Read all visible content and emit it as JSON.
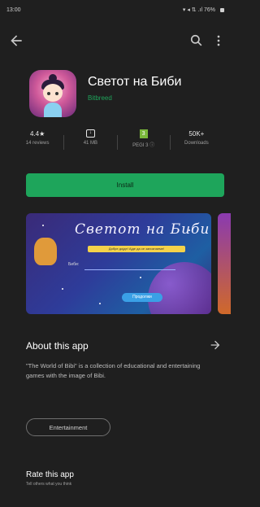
{
  "status_bar": {
    "time": "13:00",
    "icons_text": "▾ ◂ ⇅ .ıl 76%"
  },
  "app": {
    "title": "Светот на Биби",
    "developer": "Bitbreed"
  },
  "stats": [
    {
      "value": "4.4★",
      "label": "14 reviews"
    },
    {
      "value": "",
      "label": "41 MB"
    },
    {
      "value": "3",
      "label": "PEGI 3 ⓘ"
    },
    {
      "value": "50K+",
      "label": "Downloads"
    }
  ],
  "install_label": "Install",
  "screenshot": {
    "heading": "Светот на Биби",
    "subtitle": "Добре дојде! Ајде да се запознаеме!",
    "name_label": "Биби:",
    "button": "Продолжи"
  },
  "about": {
    "title": "About this app",
    "text": "\"The World of Bibi\" is a collection of educational and entertaining games with the image of Bibi."
  },
  "category_chip": "Entertainment",
  "rate": {
    "title": "Rate this app",
    "subtitle": "Tell others what you think"
  },
  "colors": {
    "background": "#1f1f1f",
    "accent": "#1ea55b"
  }
}
